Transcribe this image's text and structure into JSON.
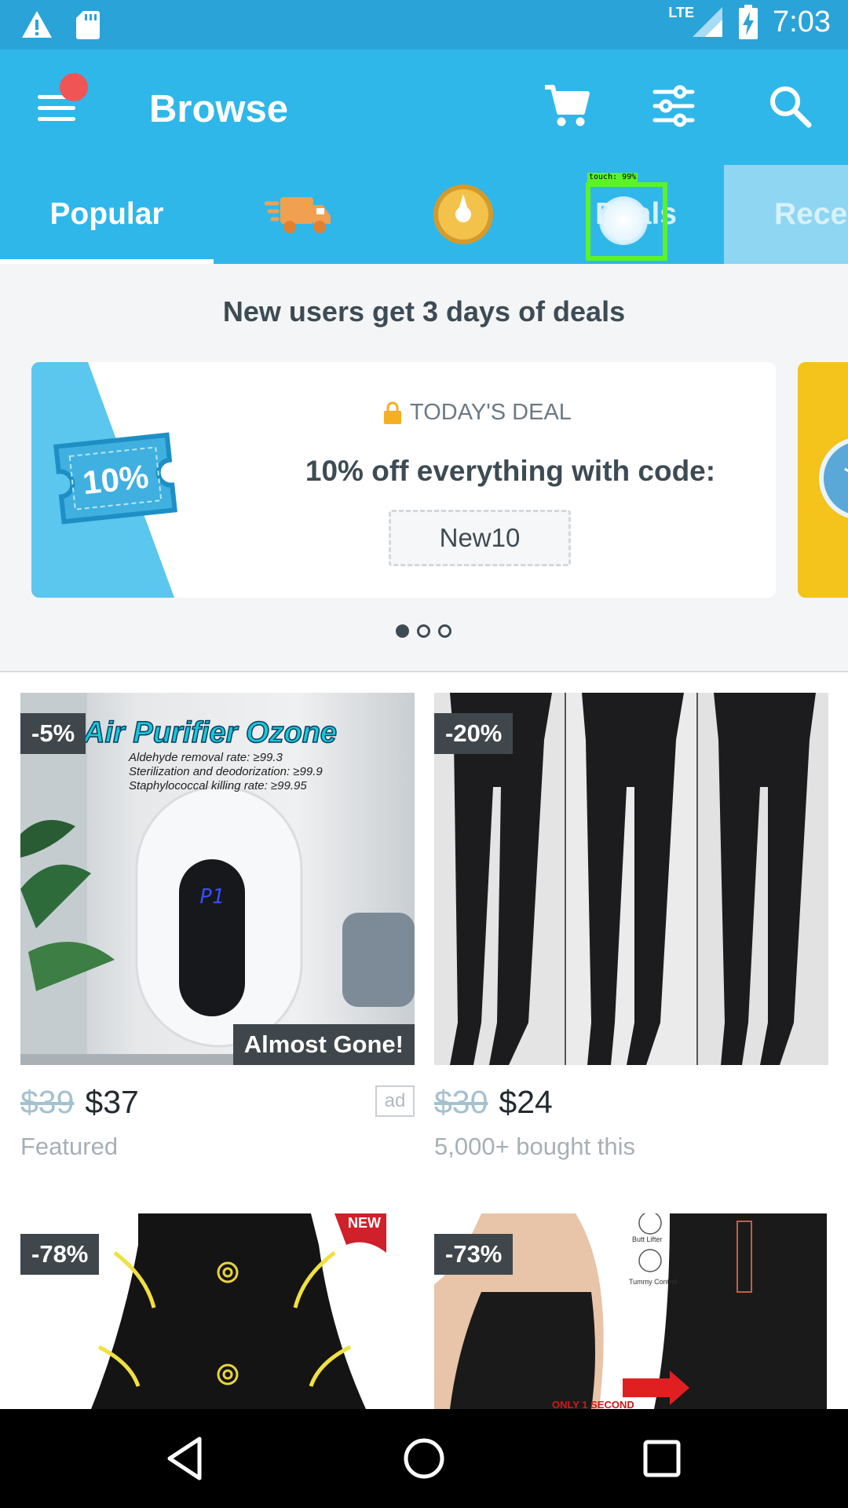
{
  "status_bar": {
    "time": "7:03",
    "network": "LTE"
  },
  "app_bar": {
    "title": "Browse"
  },
  "tabs": [
    {
      "label": "Popular",
      "active": true
    },
    {
      "label": "",
      "icon": "truck-icon"
    },
    {
      "label": "",
      "icon": "wheel-icon"
    },
    {
      "label": "Deals"
    },
    {
      "label": "Rece"
    }
  ],
  "touch_overlay": {
    "label": "touch: 99%"
  },
  "promo": {
    "heading": "New users get 3 days of deals",
    "coupon_text": "10%",
    "kicker": "TODAY'S DEAL",
    "headline": "10% off everything with code:",
    "code": "New10"
  },
  "products": [
    {
      "badge": "-5%",
      "image_title": "Air Purifier Ozone",
      "image_lines": [
        "Aldehyde removal rate: ≥99.3",
        "Sterilization and deodorization: ≥99.9",
        "Staphylococcal killing rate: ≥99.95"
      ],
      "image_screen": "P1",
      "tag": "Almost Gone!",
      "old_price": "$39",
      "price": "$37",
      "subtitle": "Featured",
      "ad_label": "ad"
    },
    {
      "badge": "-20%",
      "old_price": "$30",
      "price": "$24",
      "subtitle": "5,000+ bought this"
    },
    {
      "badge": "-78%",
      "image_corner": "NEW"
    },
    {
      "badge": "-73%",
      "image_lines": [
        "Butt Lifter",
        "Tummy Control",
        "ONLY 1 SECOND"
      ]
    }
  ]
}
